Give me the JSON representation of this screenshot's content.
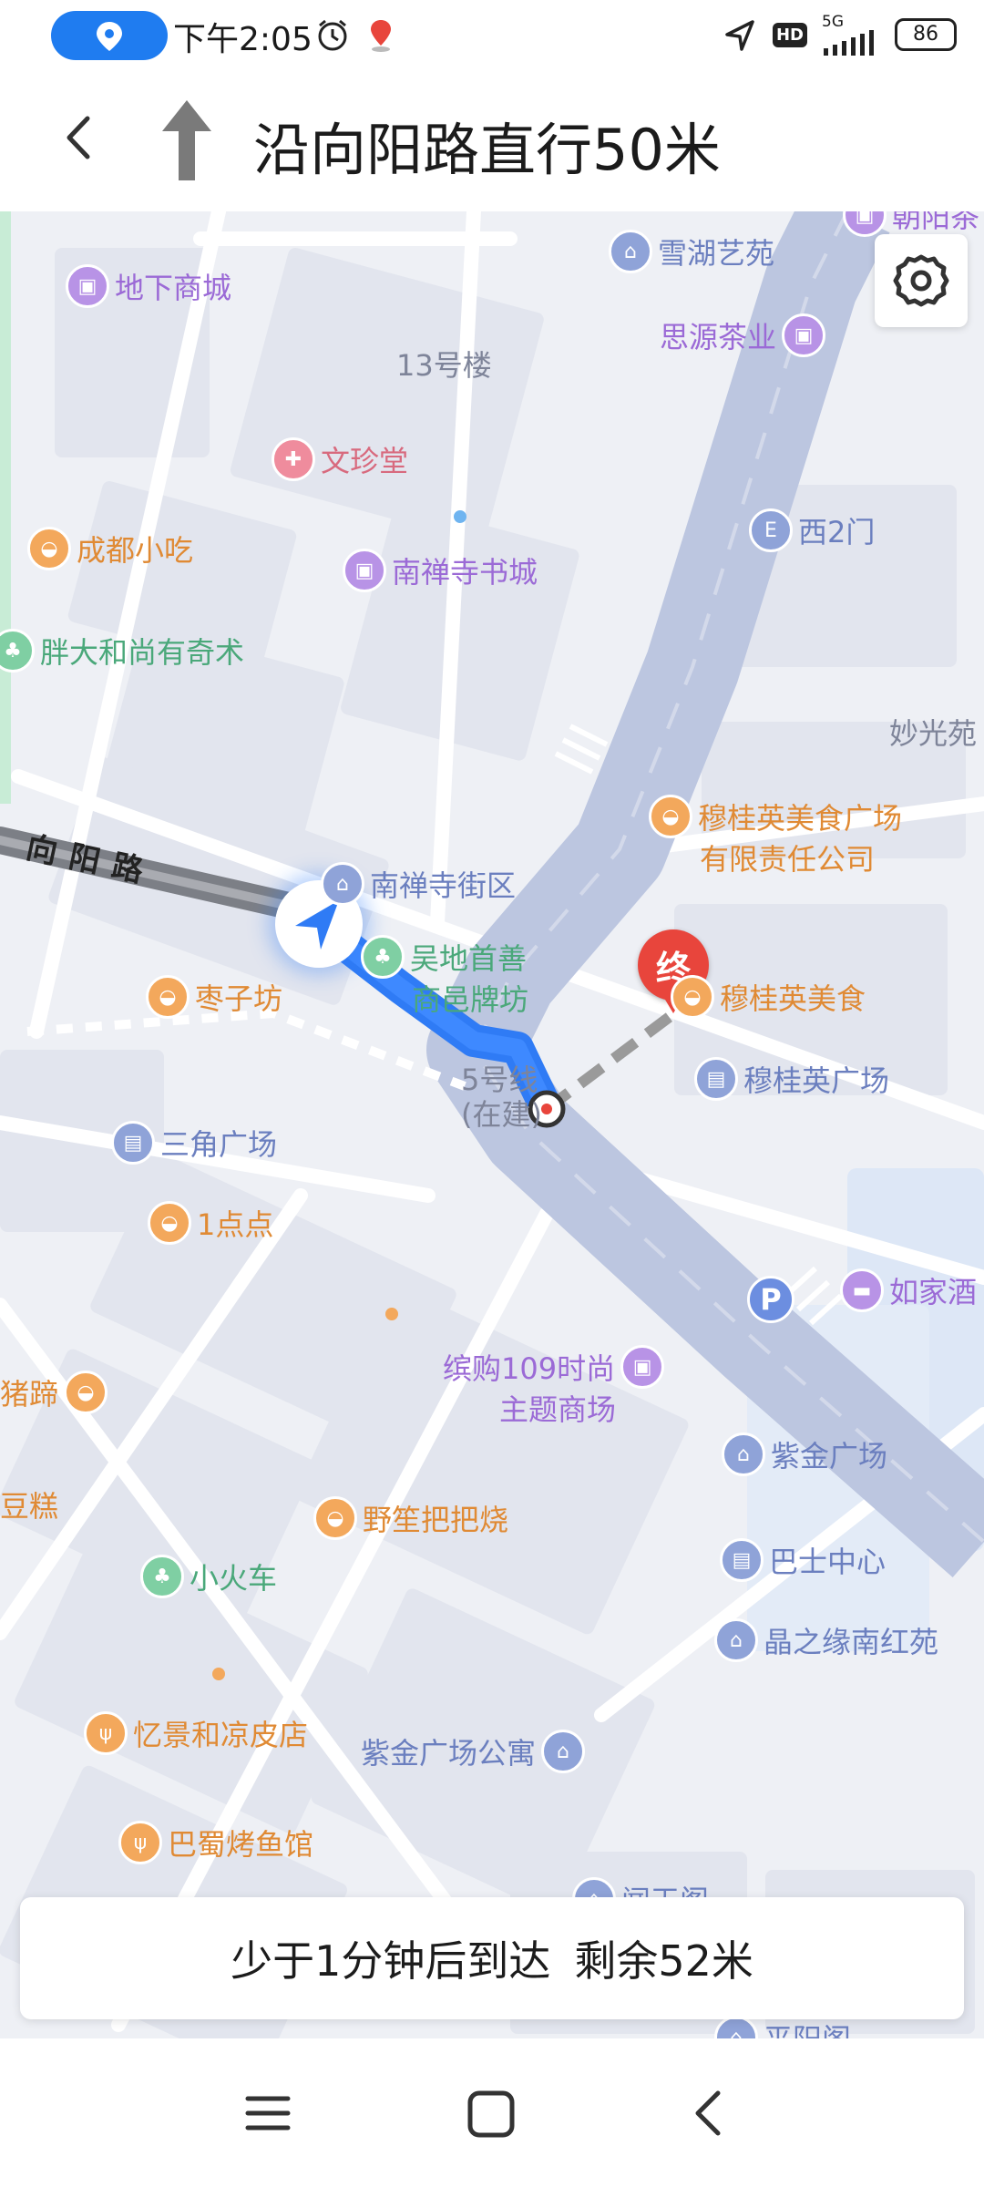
{
  "status_bar": {
    "time": "下午2:05",
    "signal_label": "5G",
    "hd_label": "HD",
    "battery": "86"
  },
  "navigation": {
    "instruction": "沿向阳路直行50米"
  },
  "map": {
    "road_name": "向阳路",
    "destination_marker": "终",
    "pois": [
      {
        "label": "雪湖艺苑",
        "icon": "building-icon",
        "color": "blue"
      },
      {
        "label": "地下商城",
        "icon": "shopping-bag-icon",
        "color": "purple"
      },
      {
        "label": "思源茶业",
        "icon": "shopping-bag-icon",
        "color": "purple"
      },
      {
        "label": "文珍堂",
        "icon": "medical-icon",
        "color": "pink"
      },
      {
        "label": "西2门",
        "icon": "gate-icon",
        "color": "blue"
      },
      {
        "label": "成都小吃",
        "icon": "food-icon",
        "color": "orange"
      },
      {
        "label": "南禅寺书城",
        "icon": "shopping-bag-icon",
        "color": "purple"
      },
      {
        "label": "胖大和尚有奇术",
        "icon": "tree-icon",
        "color": "green"
      },
      {
        "label": "穆桂英美食广场",
        "icon": "food-icon",
        "color": "orange"
      },
      {
        "label": "有限责任公司",
        "icon": "",
        "color": "orange"
      },
      {
        "label": "南禅寺街区",
        "icon": "building-icon",
        "color": "blue"
      },
      {
        "label": "吴地首善",
        "icon": "tree-icon",
        "color": "green"
      },
      {
        "label": "商邑牌坊",
        "icon": "",
        "color": "green"
      },
      {
        "label": "枣子坊",
        "icon": "food-icon",
        "color": "orange"
      },
      {
        "label": "穆桂英美食",
        "icon": "food-icon",
        "color": "orange"
      },
      {
        "label": "穆桂英广场",
        "icon": "office-icon",
        "color": "blue"
      },
      {
        "label": "三角广场",
        "icon": "office-icon",
        "color": "blue"
      },
      {
        "label": "1点点",
        "icon": "food-icon",
        "color": "orange"
      },
      {
        "label": "如家酒",
        "icon": "hotel-icon",
        "color": "purple"
      },
      {
        "label": "缤购109时尚",
        "icon": "shopping-bag-icon",
        "color": "purple"
      },
      {
        "label": "主题商场",
        "icon": "",
        "color": "purple"
      },
      {
        "label": "猪蹄",
        "icon": "food-icon",
        "color": "orange"
      },
      {
        "label": "紫金广场",
        "icon": "building-icon",
        "color": "blue"
      },
      {
        "label": "豆糕",
        "icon": "",
        "color": "orange"
      },
      {
        "label": "野笙把把烧",
        "icon": "food-icon",
        "color": "orange"
      },
      {
        "label": "巴士中心",
        "icon": "office-icon",
        "color": "blue"
      },
      {
        "label": "小火车",
        "icon": "tree-icon",
        "color": "green"
      },
      {
        "label": "晶之缘南红苑",
        "icon": "building-icon",
        "color": "blue"
      },
      {
        "label": "忆景和凉皮店",
        "icon": "restaurant-icon",
        "color": "orange"
      },
      {
        "label": "紫金广场公寓",
        "icon": "building-icon",
        "color": "blue"
      },
      {
        "label": "巴蜀烤鱼馆",
        "icon": "restaurant-icon",
        "color": "orange"
      },
      {
        "label": "闻天阁",
        "icon": "building-icon",
        "color": "blue"
      },
      {
        "label": "平阳阁",
        "icon": "building-icon",
        "color": "blue"
      },
      {
        "label": "朝阳茶",
        "icon": "shopping-bag-icon",
        "color": "purple"
      }
    ],
    "plain_labels": [
      "13号楼",
      "妙光苑",
      "5号线",
      "(在建)"
    ],
    "parking_label": "P"
  },
  "arrival": {
    "time_text": "少于1分钟后到达",
    "distance_text": "剩余52米"
  },
  "colors": {
    "route": "#2f7bf5",
    "road_fill": "#bcc6e0",
    "destination": "#e8453c",
    "background": "#eef0f5"
  }
}
